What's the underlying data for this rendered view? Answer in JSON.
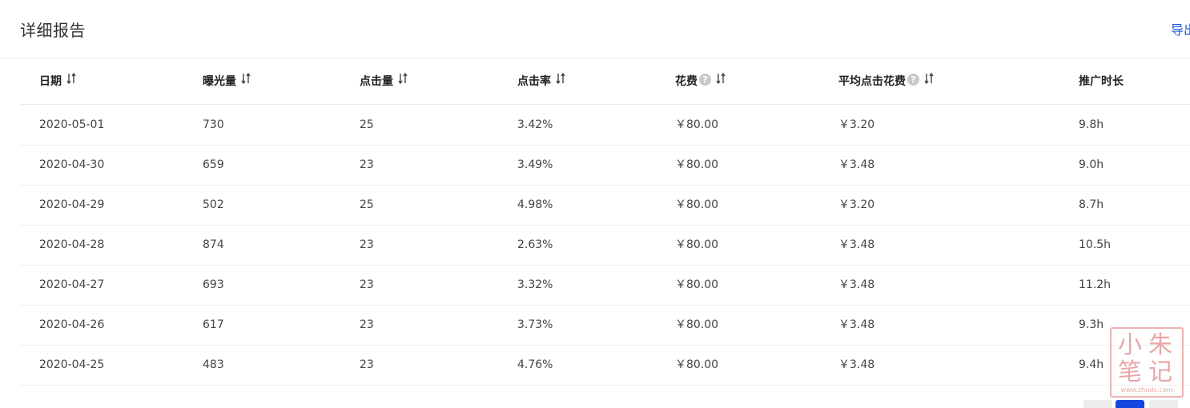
{
  "header": {
    "title": "详细报告",
    "export_label": "导出"
  },
  "table": {
    "columns": [
      {
        "label": "日期",
        "sortable": true,
        "help": false
      },
      {
        "label": "曝光量",
        "sortable": true,
        "help": false
      },
      {
        "label": "点击量",
        "sortable": true,
        "help": false
      },
      {
        "label": "点击率",
        "sortable": true,
        "help": false
      },
      {
        "label": "花费",
        "sortable": true,
        "help": true
      },
      {
        "label": "平均点击花费",
        "sortable": true,
        "help": true
      },
      {
        "label": "推广时长",
        "sortable": false,
        "help": false
      }
    ],
    "rows": [
      [
        "2020-05-01",
        "730",
        "25",
        "3.42%",
        "￥80.00",
        "￥3.20",
        "9.8h"
      ],
      [
        "2020-04-30",
        "659",
        "23",
        "3.49%",
        "￥80.00",
        "￥3.48",
        "9.0h"
      ],
      [
        "2020-04-29",
        "502",
        "25",
        "4.98%",
        "￥80.00",
        "￥3.20",
        "8.7h"
      ],
      [
        "2020-04-28",
        "874",
        "23",
        "2.63%",
        "￥80.00",
        "￥3.48",
        "10.5h"
      ],
      [
        "2020-04-27",
        "693",
        "23",
        "3.32%",
        "￥80.00",
        "￥3.48",
        "11.2h"
      ],
      [
        "2020-04-26",
        "617",
        "23",
        "3.73%",
        "￥80.00",
        "￥3.48",
        "9.3h"
      ],
      [
        "2020-04-25",
        "483",
        "23",
        "4.76%",
        "￥80.00",
        "￥3.48",
        "9.4h"
      ]
    ]
  },
  "help_glyph": "?",
  "watermark": {
    "chars": [
      "小",
      "朱",
      "笔",
      "记"
    ],
    "url": "www.zhudc.com"
  },
  "colors": {
    "accent": "#1446e0",
    "link": "#1a57d8",
    "stamp": "#e39a9a"
  }
}
